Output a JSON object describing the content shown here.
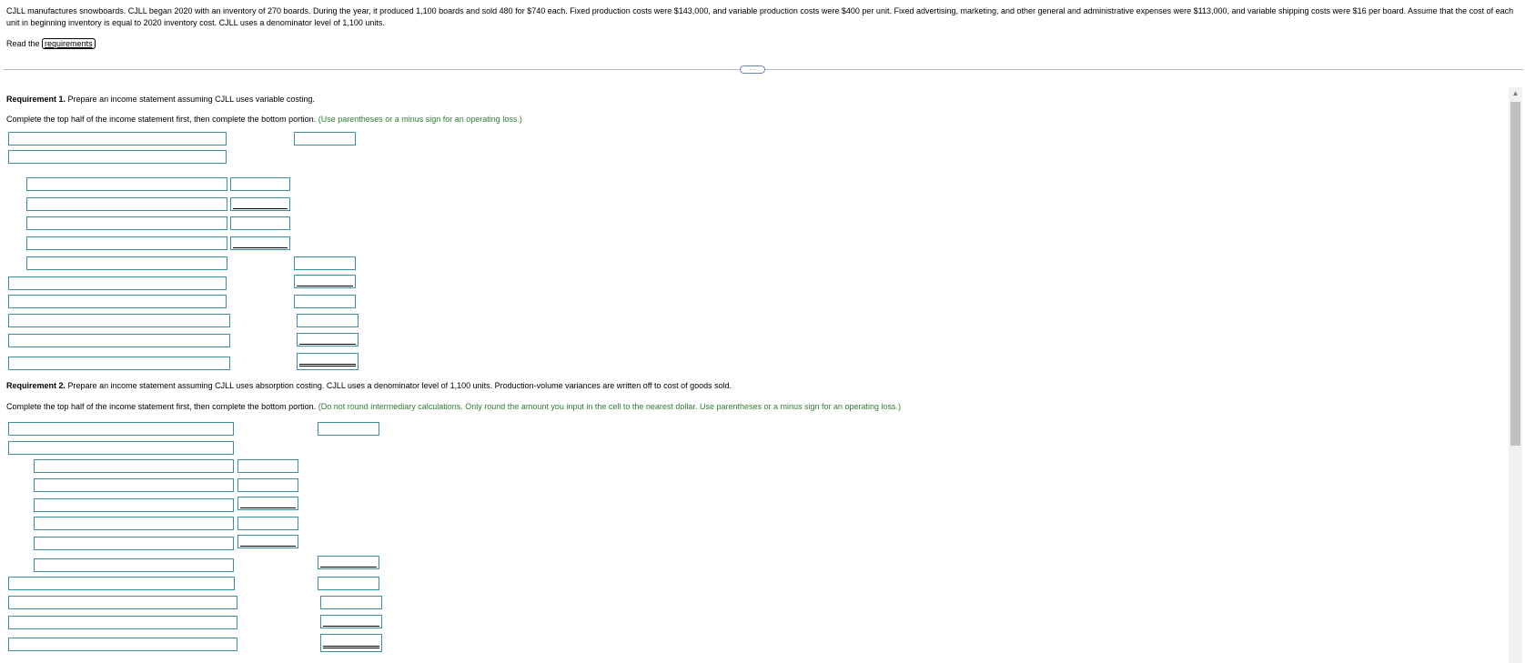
{
  "problem_text": "CJLL manufactures snowboards. CJLL began 2020 with an inventory of 270 boards. During the year, it produced 1,100 boards and sold 480 for $740 each. Fixed production costs were $143,000, and variable production costs were $400 per unit. Fixed advertising, marketing, and other general and administrative expenses were $113,000, and variable shipping costs were $16 per board. Assume that the cost of each unit in beginning inventory is equal to 2020 inventory cost. CJLL uses a denominator level of 1,100 units.",
  "read_prefix": "Read the",
  "requirements_link": "requirements",
  "collapse_label": "…",
  "req1": {
    "label": "Requirement 1.",
    "text": "Prepare an income statement assuming CJLL uses variable costing.",
    "instruction": "Complete the top half of the income statement first, then complete the bottom portion.",
    "hint": "(Use parentheses or a minus sign for an operating loss.)"
  },
  "req2": {
    "label": "Requirement 2.",
    "text": "Prepare an income statement assuming CJLL uses absorption costing. CJLL uses a denominator level of 1,100 units. Production-volume variances are written off to cost of goods sold.",
    "instruction": "Complete the top half of the income statement first, then complete the bottom portion.",
    "hint": "(Do not round intermediary calculations. Only round the amount you input in the cell to the nearest dollar. Use parentheses or a minus sign for an operating loss.)"
  },
  "scrollbar": {
    "up_arrow": "▲"
  }
}
